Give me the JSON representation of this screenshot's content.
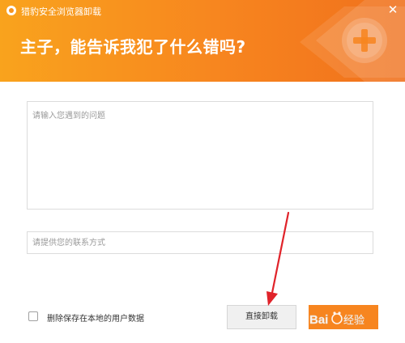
{
  "window": {
    "title": "猎豹安全浏览器卸载",
    "close_icon": "close-icon"
  },
  "header": {
    "headline": "主子，能告诉我犯了什么错吗?"
  },
  "form": {
    "problem_placeholder": "请输入您遇到的问题",
    "problem_value": "",
    "contact_placeholder": "请提供您的联系方式",
    "contact_value": "",
    "delete_data_label": "删除保存在本地的用户数据",
    "delete_data_checked": false
  },
  "buttons": {
    "uninstall_label": "直接卸载",
    "cancel_label": ""
  },
  "colors": {
    "header_start": "#f9a31d",
    "header_end": "#f0701c",
    "accent": "#f7851f",
    "annotation_arrow": "#e0232a"
  },
  "watermark_text": "Baidu 经验"
}
